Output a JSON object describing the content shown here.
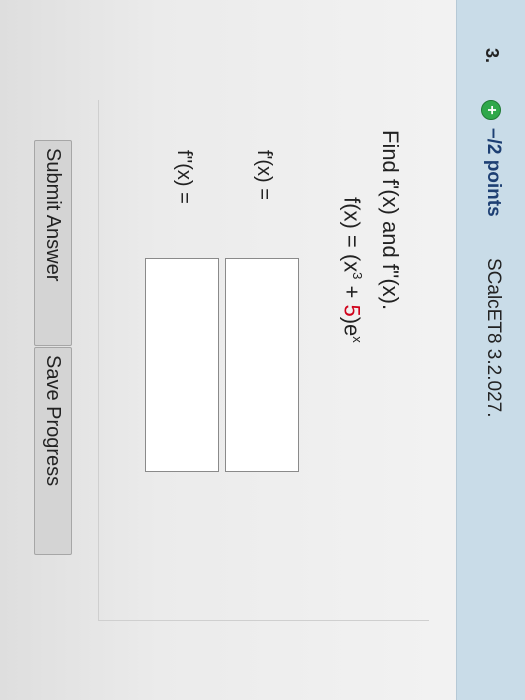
{
  "question": {
    "number": "3.",
    "points": "–/2 points",
    "source": "SCalcET8 3.2.027.",
    "prompt": "Find f'(x) and f''(x).",
    "equation": {
      "lhs": "f(x) = (x",
      "exponent": "3",
      "plus": " + ",
      "constant": "5",
      "rhs": ")e",
      "e_exponent": "x"
    },
    "first_derivative_label": "f'(x) =",
    "second_derivative_label": "f''(x) =",
    "first_derivative_value": "",
    "second_derivative_value": ""
  },
  "buttons": {
    "submit": "Submit Answer",
    "save": "Save Progress"
  },
  "icons": {
    "status": "plus-circle-icon"
  },
  "colors": {
    "header_bg": "#c9dce8",
    "points_text": "#1d3f73",
    "status_icon": "#2fa84a",
    "equation_constant": "#d0021b"
  }
}
